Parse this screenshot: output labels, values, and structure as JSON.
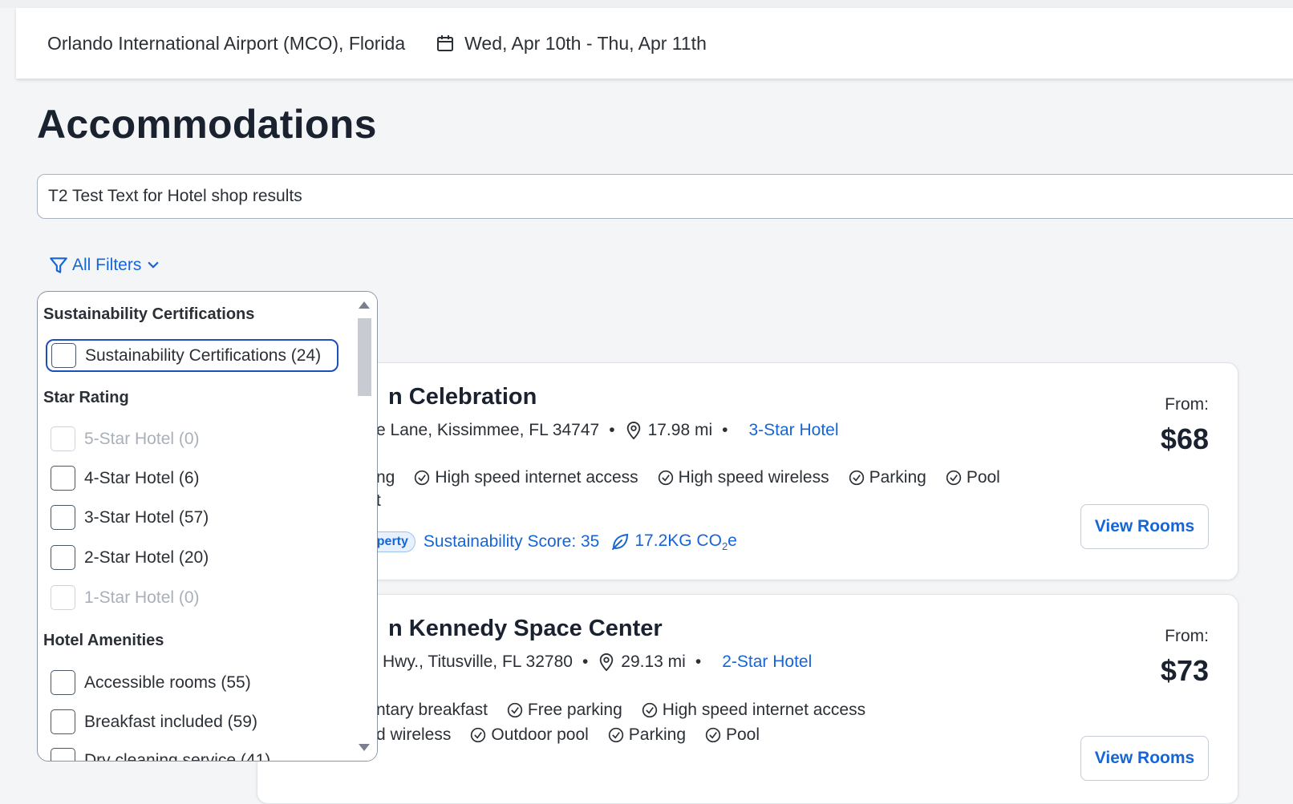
{
  "header": {
    "location": "Orlando International Airport (MCO), Florida",
    "dates": "Wed, Apr 10th - Thu, Apr 11th"
  },
  "page": {
    "title": "Accommodations",
    "notice": "T2 Test Text for Hotel shop results",
    "filters_label": "All Filters"
  },
  "filters": {
    "sustainability": {
      "heading": "Sustainability Certifications",
      "options": [
        {
          "label": "Sustainability Certifications (24)",
          "checked": false
        }
      ]
    },
    "star_rating": {
      "heading": "Star Rating",
      "options": [
        {
          "label": "5-Star Hotel (0)",
          "disabled": true
        },
        {
          "label": "4-Star Hotel (6)",
          "disabled": false
        },
        {
          "label": "3-Star Hotel (57)",
          "disabled": false
        },
        {
          "label": "2-Star Hotel (20)",
          "disabled": false
        },
        {
          "label": "1-Star Hotel (0)",
          "disabled": true
        }
      ]
    },
    "amenities": {
      "heading": "Hotel Amenities",
      "options": [
        {
          "label": "Accessible rooms (55)"
        },
        {
          "label": "Breakfast included (59)"
        },
        {
          "label": "Dry cleaning service (41)"
        }
      ]
    }
  },
  "hotels": [
    {
      "name": "n Celebration",
      "address": "e Lane, Kissimmee, FL 34747",
      "distance": "17.98 mi",
      "stars": "3-Star Hotel",
      "amenities_row1_partial": "ng",
      "amenities_row1": [
        "High speed internet access",
        "High speed wireless",
        "Parking",
        "Pool"
      ],
      "amenities_row2_partial": "t",
      "badge": "operty",
      "sustainability_score": "Sustainability Score: 35",
      "co2": "17.2KG CO",
      "co2_sub": "2",
      "co2_suffix": "e",
      "from_label": "From:",
      "price": "$68",
      "button": "View Rooms"
    },
    {
      "name": "n Kennedy Space Center",
      "address": "Hwy., Titusville, FL 32780",
      "distance": "29.13 mi",
      "stars": "2-Star Hotel",
      "amenities_row1_partial": "ntary breakfast",
      "amenities_row1": [
        "Free parking",
        "High speed internet access"
      ],
      "amenities_row2_partial": "d wireless",
      "amenities_row2": [
        "Outdoor pool",
        "Parking",
        "Pool"
      ],
      "from_label": "From:",
      "price": "$73",
      "button": "View Rooms"
    }
  ]
}
